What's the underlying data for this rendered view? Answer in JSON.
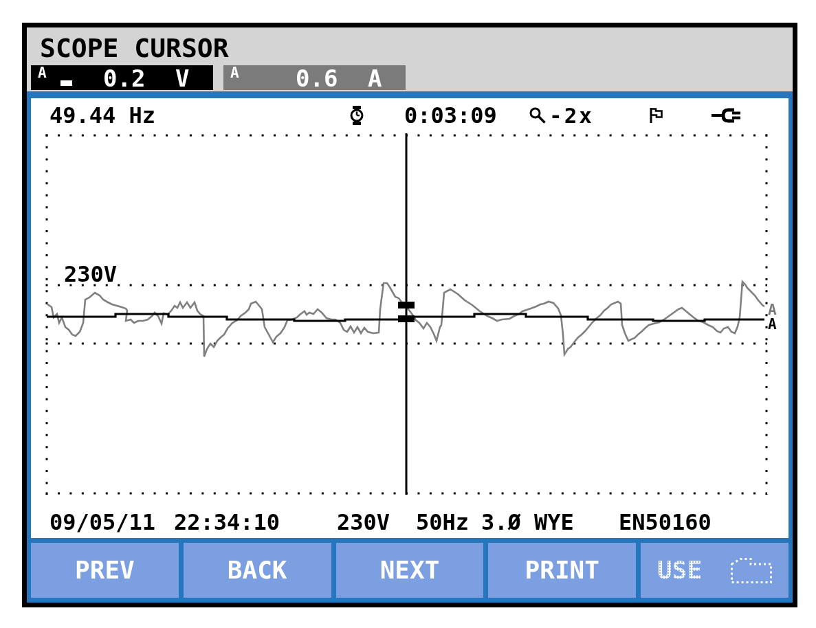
{
  "header": {
    "title": "SCOPE CURSOR",
    "readouts": [
      {
        "phase": "A",
        "value": "0.2",
        "unit": "V",
        "selected": true
      },
      {
        "phase": "A",
        "value": "0.6",
        "unit": "A",
        "selected": false
      }
    ]
  },
  "status_bar": {
    "frequency": "49.44 Hz",
    "elapsed_time": "0:03:09",
    "zoom": "-2x"
  },
  "plot": {
    "reference_label": "230V",
    "trace_labels": [
      {
        "text": "A",
        "kind": "current"
      },
      {
        "text": "A",
        "kind": "voltage"
      }
    ]
  },
  "info_bar": {
    "date": "09/05/11",
    "time": "22:34:10",
    "nominal_voltage": "230V",
    "nominal_frequency": "50Hz",
    "configuration": "3.Ø WYE",
    "standard": "EN50160"
  },
  "softkeys": [
    {
      "label": "PREV",
      "kind": "text",
      "disabled": false
    },
    {
      "label": "BACK",
      "kind": "text",
      "disabled": false
    },
    {
      "label": "NEXT",
      "kind": "text",
      "disabled": false
    },
    {
      "label": "PRINT",
      "kind": "text",
      "disabled": false
    },
    {
      "label": "USE",
      "kind": "storage",
      "disabled": true
    }
  ]
}
